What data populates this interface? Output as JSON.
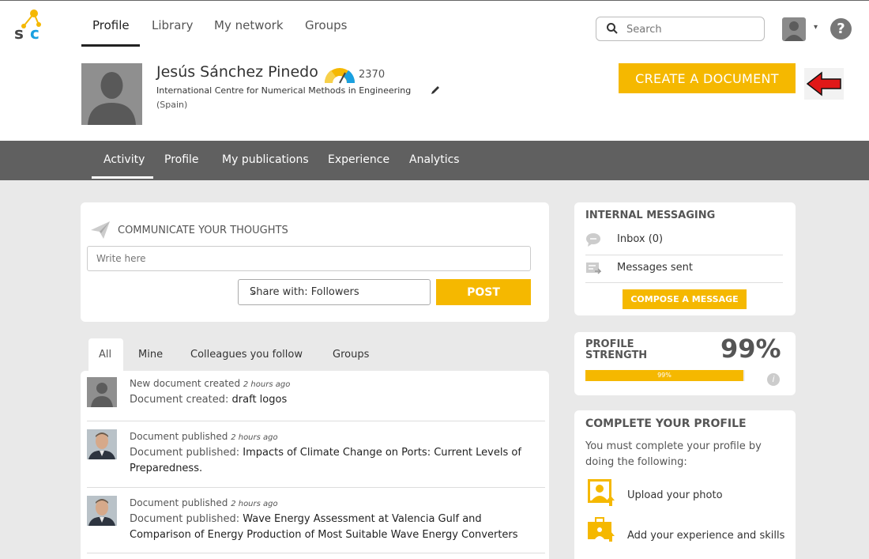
{
  "topnav": {
    "logo": "s c",
    "items": [
      "Profile",
      "Library",
      "My network",
      "Groups"
    ],
    "search_placeholder": "Search",
    "caret": "▾",
    "help": "?"
  },
  "header": {
    "name": "Jesús Sánchez Pinedo",
    "score": "2370",
    "institution": "International Centre for Numerical Methods in Engineering",
    "country": "(Spain)",
    "create_label": "CREATE A DOCUMENT"
  },
  "secnav": {
    "items": [
      "Activity",
      "Profile",
      "My publications",
      "Experience",
      "Analytics"
    ]
  },
  "thoughts": {
    "title": "COMMUNICATE YOUR THOUGHTS",
    "placeholder": "Write here",
    "share_value": "Share with: Followers",
    "post_label": "POST"
  },
  "feed": {
    "tabs": [
      "All",
      "Mine",
      "Colleagues you follow",
      "Groups"
    ],
    "items": [
      {
        "meta": "New document created",
        "time": "2 hours ago",
        "prefix": "Document created:",
        "title": "draft logos"
      },
      {
        "meta": "Document published",
        "time": "2 hours ago",
        "prefix": "Document published:",
        "title": "Impacts of Climate Change on Ports: Current Levels of Preparedness."
      },
      {
        "meta": "Document published",
        "time": "2 hours ago",
        "prefix": "Document published:",
        "title": "Wave Energy Assessment at Valencia Gulf and Comparison of Energy Production of Most Suitable Wave Energy Converters"
      }
    ]
  },
  "messaging": {
    "title": "INTERNAL MESSAGING",
    "inbox": "Inbox (0)",
    "sent": "Messages sent",
    "compose_label": "COMPOSE A MESSAGE"
  },
  "strength": {
    "title_line1": "PROFILE",
    "title_line2": "STRENGTH",
    "percent": "99%",
    "bar_label": "99%",
    "value": 0.99,
    "info": "i"
  },
  "complete": {
    "title": "COMPLETE YOUR PROFILE",
    "desc": "You must complete your profile by doing the following:",
    "tasks": [
      "Upload your photo",
      "Add your experience and skills"
    ]
  },
  "colors": {
    "accent": "#f5b800",
    "secnav_bg": "#606060",
    "page_bg": "#e9e9e9"
  }
}
